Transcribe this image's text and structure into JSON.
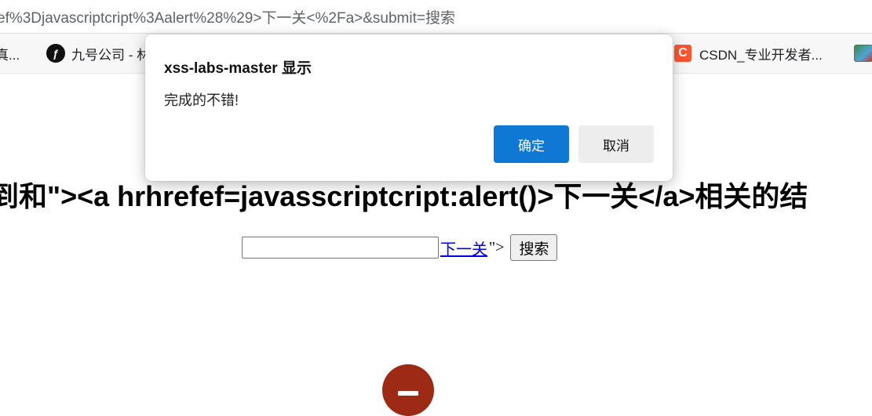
{
  "address_bar": {
    "url_text": "ef%3Djavascriptcript%3Aalert%28%29>下一关<%2Fa>&submit=搜索"
  },
  "bookmarks": [
    {
      "label": "真...",
      "icon": "page-icon"
    },
    {
      "label": "九号公司 - 林",
      "icon": "ninebot-icon"
    },
    {
      "label": "CSDN_专业开发者...",
      "icon": "csdn-icon"
    },
    {
      "label": "",
      "icon": "tray-icon"
    }
  ],
  "page": {
    "heading": "到和\"><a hrhrefef=javasscriptcript:alert()>下一关</a>相关的结",
    "search_value": "",
    "link_text": "下一关",
    "tail_text": "\">",
    "search_button": "搜索"
  },
  "dialog": {
    "title": "xss-labs-master 显示",
    "message": "完成的不错!",
    "ok_label": "确定",
    "cancel_label": "取消"
  },
  "colors": {
    "accent": "#0f78d4",
    "link": "#0000ee",
    "logo": "#9d2a14"
  }
}
